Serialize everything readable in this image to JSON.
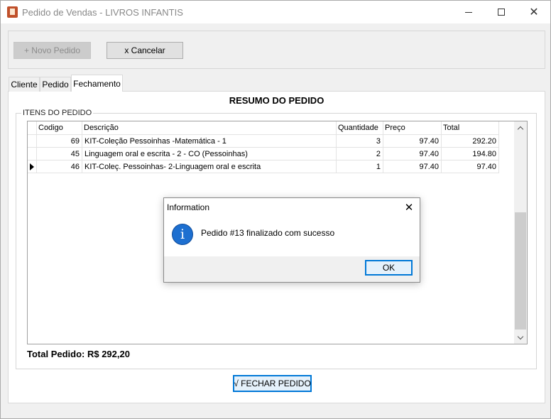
{
  "window": {
    "title": "Pedido de Vendas - LIVROS INFANTIS",
    "minimize_glyph": "",
    "close_glyph": "✕"
  },
  "toolbar": {
    "new_order_label": "+ Novo Pedido",
    "cancel_label": "x Cancelar"
  },
  "tabs": [
    {
      "label": "Cliente"
    },
    {
      "label": "Pedido"
    },
    {
      "label": "Fechamento",
      "active": true
    }
  ],
  "summary": {
    "title": "RESUMO DO PEDIDO",
    "group_label": "ITENS DO PEDIDO",
    "columns": [
      "Codigo",
      "Descrição",
      "Quantidade",
      "Preço",
      "Total"
    ],
    "rows": [
      {
        "codigo": "69",
        "descricao": "KIT-Coleção Pessoinhas -Matemática - 1",
        "quantidade": "3",
        "preco": "97.40",
        "total": "292.20",
        "current": false
      },
      {
        "codigo": "45",
        "descricao": "Linguagem oral e escrita - 2 - CO (Pessoinhas)",
        "quantidade": "2",
        "preco": "97.40",
        "total": "194.80",
        "current": false
      },
      {
        "codigo": "46",
        "descricao": "KIT-Coleç. Pessoinhas- 2-Linguagem oral e escrita",
        "quantidade": "1",
        "preco": "97.40",
        "total": "97.40",
        "current": true
      }
    ],
    "total_label": "Total Pedido: R$ 292,20"
  },
  "finish_button_label": "√ FECHAR PEDIDO",
  "dialog": {
    "title": "Information",
    "close_glyph": "✕",
    "icon": "info-icon",
    "icon_glyph": "i",
    "message": "Pedido #13 finalizado com sucesso",
    "ok_label": "OK"
  },
  "colors": {
    "accent": "#0078d7",
    "info_icon": "#1d6fd0",
    "app_icon": "#c0502a"
  }
}
